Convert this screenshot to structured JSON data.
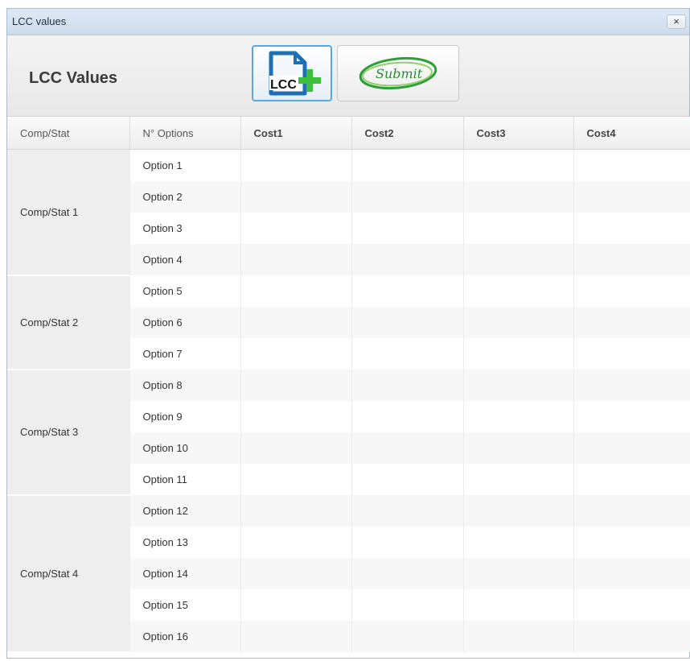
{
  "window": {
    "title": "LCC values",
    "close_label": "×"
  },
  "toolbar": {
    "heading": "LCC Values",
    "lcc_button_icon": "lcc-add-icon",
    "lcc_icon_text": "LCC",
    "submit_button_icon": "submit-icon",
    "submit_icon_text": "Submit"
  },
  "table": {
    "columns": [
      "Comp/Stat",
      "N° Options",
      "Cost1",
      "Cost2",
      "Cost3",
      "Cost4"
    ],
    "groups": [
      {
        "label": "Comp/Stat 1",
        "options": [
          "Option 1",
          "Option 2",
          "Option 3",
          "Option 4"
        ]
      },
      {
        "label": "Comp/Stat 2",
        "options": [
          "Option 5",
          "Option 6",
          "Option 7"
        ]
      },
      {
        "label": "Comp/Stat 3",
        "options": [
          "Option 8",
          "Option 9",
          "Option 10",
          "Option 11"
        ]
      },
      {
        "label": "Comp/Stat 4",
        "options": [
          "Option 12",
          "Option 13",
          "Option 14",
          "Option 15",
          "Option 16"
        ]
      }
    ]
  },
  "colors": {
    "titlebar": "#dfe9f5",
    "lcc_blue": "#1f6fb3",
    "lcc_green": "#3cc13c",
    "submit_green": "#2f9e3a"
  }
}
